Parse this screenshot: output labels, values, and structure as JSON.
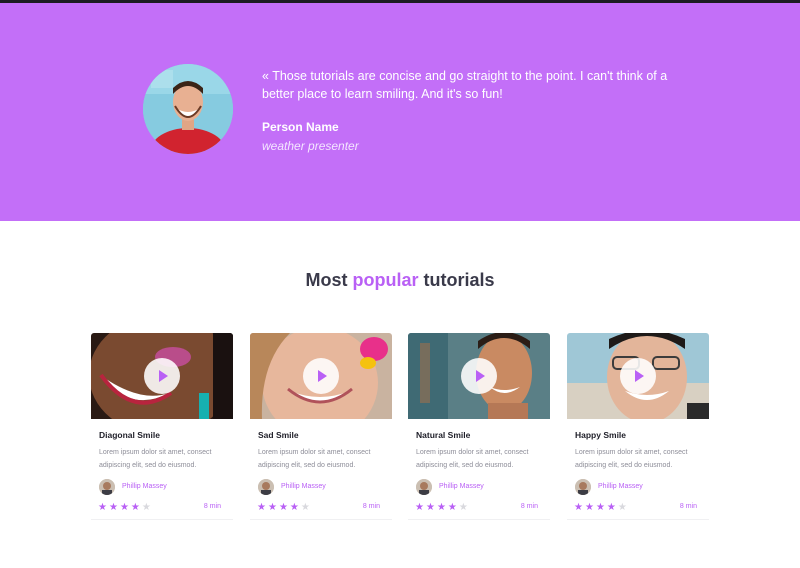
{
  "testimonial": {
    "quote": "« Those tutorials are concise and go straight to the point. I can't think of a better place to learn smiling. And it's so fun!",
    "name": "Person Name",
    "role": "weather presenter"
  },
  "section": {
    "title_prefix": "Most ",
    "title_highlight": "popular",
    "title_suffix": " tutorials"
  },
  "cards": [
    {
      "title": "Diagonal Smile",
      "desc": "Lorem ipsum dolor sit amet, consect adipiscing elit, sed do eiusmod.",
      "author": "Phillip Massey",
      "rating": 4,
      "rating_max": 5,
      "duration": "8 min"
    },
    {
      "title": "Sad Smile",
      "desc": "Lorem ipsum dolor sit amet, consect adipiscing elit, sed do eiusmod.",
      "author": "Phillip Massey",
      "rating": 4,
      "rating_max": 5,
      "duration": "8 min"
    },
    {
      "title": "Natural Smile",
      "desc": "Lorem ipsum dolor sit amet, consect adipiscing elit, sed do eiusmod.",
      "author": "Phillip Massey",
      "rating": 4,
      "rating_max": 5,
      "duration": "8 min"
    },
    {
      "title": "Happy Smile",
      "desc": "Lorem ipsum dolor sit amet, consect adipiscing elit, sed do eiusmod.",
      "author": "Phillip Massey",
      "rating": 4,
      "rating_max": 5,
      "duration": "8 min"
    }
  ],
  "colors": {
    "hero_bg": "#c36ff8",
    "accent": "#b960f5",
    "star_off": "#d9d9de"
  },
  "icons": [
    "play-icon",
    "star-icon"
  ]
}
